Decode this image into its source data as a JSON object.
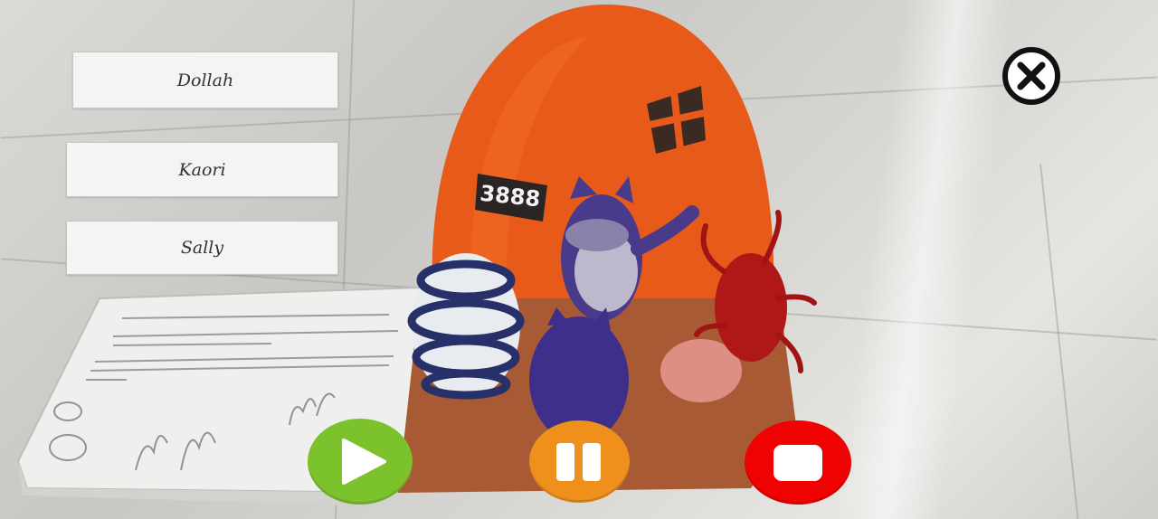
{
  "characters": {
    "buttons": [
      "Dollah",
      "Kaori",
      "Sally"
    ]
  },
  "scene": {
    "house_number": "3888"
  },
  "icons": {
    "close": "close-circle-icon",
    "play": "play-icon",
    "pause": "pause-icon",
    "stop": "stop-icon"
  },
  "colors": {
    "play": "#7cc22d",
    "pause": "#f0901c",
    "stop": "#ee0202",
    "button_bg": "#f4f4f4"
  }
}
